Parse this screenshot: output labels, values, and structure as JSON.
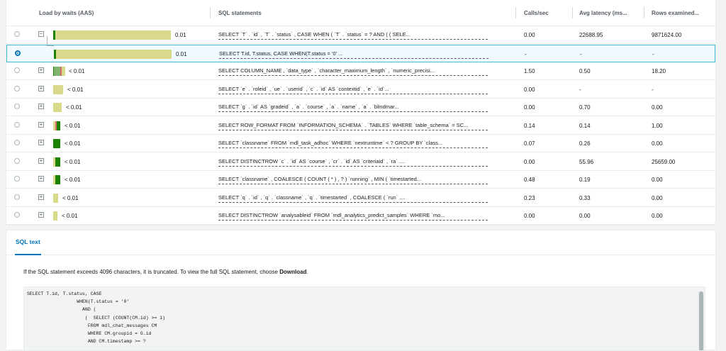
{
  "table": {
    "columns": [
      "Load by waits (AAS)",
      "SQL statements",
      "Calls/sec",
      "Avg latency (ms...",
      "Rows examined..."
    ],
    "rows": [
      {
        "load": "0.01",
        "sql": "SELECT `T` . `id` , `T` . `status` , CASE WHEN ( `T` . `status` = ? AND ( ( SELE...",
        "calls": "0.00",
        "latency": "22688.95",
        "rows": "9871624.00",
        "expander": "−",
        "selected": false,
        "child": false,
        "bar": [
          {
            "fill": 0.02,
            "color": "#1d8102"
          },
          {
            "fill": 0.98,
            "color": "#d8d98a"
          }
        ]
      },
      {
        "load": "0.01",
        "sql": "SELECT T.id, T.status, CASE WHEN(T.status = '0' ...",
        "calls": "-",
        "latency": "-",
        "rows": "-",
        "expander": "",
        "selected": true,
        "child": true,
        "bar": [
          {
            "fill": 0.02,
            "color": "#1d8102"
          },
          {
            "fill": 0.98,
            "color": "#d8d98a"
          }
        ]
      },
      {
        "load": "< 0.01",
        "sql": "SELECT COLUMN_NAME , `data_type` , `character_maximum_length` , `numeric_precisi...",
        "calls": "1.50",
        "latency": "0.50",
        "rows": "18.20",
        "expander": "+",
        "selected": false,
        "child": false,
        "bar": [
          {
            "fill": 0.03,
            "color": "#1d8102"
          },
          {
            "fill": 0.55,
            "color": "#80b36f"
          },
          {
            "fill": 0.12,
            "color": "#d96b6b"
          },
          {
            "fill": 0.3,
            "color": "#d8d98a"
          }
        ]
      },
      {
        "load": "< 0.01",
        "sql": "SELECT `e` . `roleid` , `ue` . `userid` , `c` . `id` AS `contextid` , `e` . `id`...",
        "calls": "0.00",
        "latency": "-",
        "rows": "-",
        "expander": "+",
        "selected": false,
        "child": false,
        "bar": [
          {
            "fill": 1.0,
            "color": "#d8d98a"
          }
        ]
      },
      {
        "load": "< 0.01",
        "sql": "SELECT `g` . `id` AS `gradeid` , `a` . `course` , `a` . `name` , `a` . `blindmar...",
        "calls": "0.00",
        "latency": "0.70",
        "rows": "0.00",
        "expander": "+",
        "selected": false,
        "child": false,
        "bar": [
          {
            "fill": 1.0,
            "color": "#d8d98a"
          }
        ]
      },
      {
        "load": "< 0.01",
        "sql": "SELECT ROW_FORMAT FROM `INFORMATION_SCHEMA` . `TABLES` WHERE `table_schema` = SC...",
        "calls": "0.14",
        "latency": "0.14",
        "rows": "1.00",
        "expander": "+",
        "selected": false,
        "child": false,
        "bar": [
          {
            "fill": 0.3,
            "color": "#d8d98a"
          },
          {
            "fill": 0.2,
            "color": "#d96b6b"
          },
          {
            "fill": 0.5,
            "color": "#1d8102"
          }
        ]
      },
      {
        "load": "< 0.01",
        "sql": "SELECT `classname` FROM `mdl_task_adhoc` WHERE `nextruntime` < ? GROUP BY `class...",
        "calls": "0.07",
        "latency": "0.26",
        "rows": "0.00",
        "expander": "+",
        "selected": false,
        "child": false,
        "bar": [
          {
            "fill": 1.0,
            "color": "#1d8102"
          }
        ]
      },
      {
        "load": "< 0.01",
        "sql": "SELECT DISTINCTROW `c` . `id` AS `course` , `cr` . `id` AS `criteriaid` , `ra` ....",
        "calls": "0.00",
        "latency": "55.96",
        "rows": "25659.00",
        "expander": "+",
        "selected": false,
        "child": false,
        "bar": [
          {
            "fill": 0.3,
            "color": "#d8d98a"
          },
          {
            "fill": 0.7,
            "color": "#1d8102"
          }
        ]
      },
      {
        "load": "< 0.01",
        "sql": "SELECT `classname` , COALESCE ( COUNT ( * ) , ? ) `running` , MIN ( `timestarted...",
        "calls": "0.48",
        "latency": "0.19",
        "rows": "0.00",
        "expander": "+",
        "selected": false,
        "child": false,
        "bar": [
          {
            "fill": 0.3,
            "color": "#d8d98a"
          },
          {
            "fill": 0.7,
            "color": "#1d8102"
          }
        ]
      },
      {
        "load": "< 0.01",
        "sql": "SELECT `q` . `id` , `q` . `classname` , `q` . `timestarted` , COALESCE ( `run` ....",
        "calls": "0.23",
        "latency": "0.33",
        "rows": "0.00",
        "expander": "+",
        "selected": false,
        "child": false,
        "bar": [
          {
            "fill": 1.0,
            "color": "#d8d98a"
          }
        ]
      },
      {
        "load": "< 0.01",
        "sql": "SELECT DISTINCTROW `analysableid` FROM `mdl_analytics_predict_samples` WHERE `mo...",
        "calls": "0.00",
        "latency": "0.00",
        "rows": "0.00",
        "expander": "+",
        "selected": false,
        "child": false,
        "bar": [
          {
            "fill": 1.0,
            "color": "#d8d98a"
          }
        ]
      }
    ]
  },
  "panel": {
    "tab": "SQL text",
    "note_pre": "If the SQL statement exceeds 4096 characters, it is truncated. To view the full SQL statement, choose ",
    "note_bold": "Download",
    "note_post": ".",
    "code": "SELECT T.id, T.status, CASE\n                  WHEN(T.status = '0'\n                    AND (\n                     (  SELECT (COUNT(CM.id) >= 1)\n                      FROM mdl_chat_messages CM\n                      WHERE CM.groupid = G.id\n                      AND CM.timestamp >= ?"
  },
  "colors": {
    "accent": "#0073bb",
    "selected_row_bg": "#f1faff",
    "selected_row_border": "#44b9d6"
  }
}
